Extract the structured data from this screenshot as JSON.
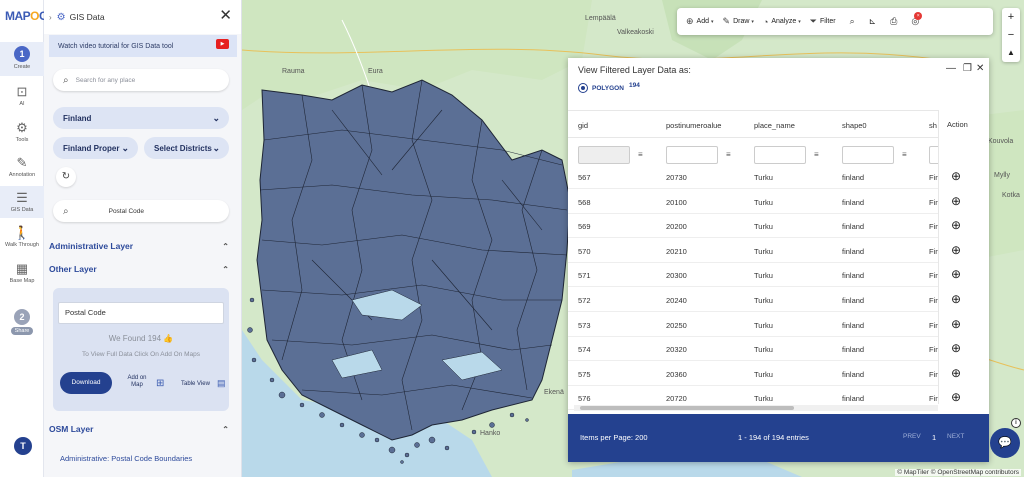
{
  "rail": {
    "logo_a": "MAP",
    "logo_b": "O",
    "logo_c": "C",
    "items": [
      {
        "step": "1",
        "label": "Create"
      },
      {
        "label": "AI"
      },
      {
        "label": "Tools"
      },
      {
        "label": "Annotation"
      },
      {
        "label": "GIS Data"
      },
      {
        "label": "Walk Through"
      },
      {
        "label": "Base Map"
      },
      {
        "step": "2",
        "label": "Share"
      }
    ],
    "help": "T"
  },
  "panel": {
    "title": "GIS Data",
    "tutorial": "Watch video tutorial for GIS Data tool",
    "search_placeholder": "Search for any place",
    "country": "Finland",
    "region": "Finland Proper",
    "districts": "Select Districts",
    "postal_search": "Postal Code",
    "admin_layer": "Administrative Layer",
    "other_layer": "Other Layer",
    "postal_input": "Postal Code",
    "found_prefix": "We Found",
    "found_count": "194",
    "hint": "To View Full Data Click On Add On Maps",
    "download": "Download",
    "add_on_map_1": "Add on",
    "add_on_map_2": "Map",
    "table_view": "Table View",
    "osm_layer": "OSM Layer",
    "osm_link": "Administrative: Postal Code Boundaries"
  },
  "toolbar": {
    "add": "Add",
    "draw": "Draw",
    "analyze": "Analyze",
    "filter": "Filter"
  },
  "map_labels": [
    "Lempäälä",
    "Valkeakoski",
    "Rauma",
    "Eura",
    "Kouvola",
    "Mylly",
    "Kotka",
    "Ekenä",
    "Hanko"
  ],
  "table": {
    "title": "View Filtered Layer Data as:",
    "geom_type": "POLYGON",
    "geom_count": "194",
    "columns": [
      "gid",
      "postinumeroalue",
      "place_name",
      "shape0",
      "sh",
      "Action"
    ],
    "rows": [
      [
        "567",
        "20730",
        "Turku",
        "finland",
        "Fin"
      ],
      [
        "568",
        "20100",
        "Turku",
        "finland",
        "Fin"
      ],
      [
        "569",
        "20200",
        "Turku",
        "finland",
        "Fin"
      ],
      [
        "570",
        "20210",
        "Turku",
        "finland",
        "Fin"
      ],
      [
        "571",
        "20300",
        "Turku",
        "finland",
        "Fin"
      ],
      [
        "572",
        "20240",
        "Turku",
        "finland",
        "Fin"
      ],
      [
        "573",
        "20250",
        "Turku",
        "finland",
        "Fin"
      ],
      [
        "574",
        "20320",
        "Turku",
        "finland",
        "Fin"
      ],
      [
        "575",
        "20360",
        "Turku",
        "finland",
        "Fin"
      ],
      [
        "576",
        "20720",
        "Turku",
        "finland",
        "Fin"
      ]
    ],
    "items_per_page": "Items per Page: 200",
    "range": "1 - 194 of 194 entries",
    "prev": "PREV",
    "page": "1",
    "next": "NEXT"
  },
  "map_credit": "© MapTiler © OpenStreetMap contributors",
  "colors": {
    "primary": "#24418f",
    "accent": "#f6a821",
    "polygon_fill": "#5b6f95"
  }
}
